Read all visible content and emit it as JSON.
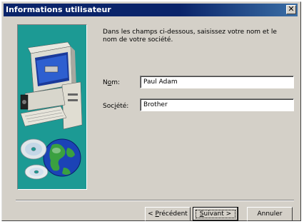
{
  "window": {
    "title": "Informations utilisateur",
    "close_label": "✕"
  },
  "instructions": "Dans les champs ci-dessous, saisissez votre nom et le nom de votre société.",
  "form": {
    "name_label_pre": "N",
    "name_label_mnemonic": "o",
    "name_label_post": "m:",
    "name_value": "Paul Adam",
    "company_label_pre": "Soc",
    "company_label_mnemonic": "i",
    "company_label_post": "été:",
    "company_value": "Brother"
  },
  "buttons": {
    "back_pre": "< ",
    "back_mnemonic": "P",
    "back_post": "récédent",
    "next_mnemonic": "S",
    "next_post": "uivant >",
    "cancel": "Annuler"
  },
  "colors": {
    "titlebar": "#0a246a",
    "dialog_bg": "#d4d0c8",
    "illustration_bg": "#1c9a94"
  },
  "icons": [
    "computer-icon",
    "globe-icon",
    "cd-icon"
  ]
}
